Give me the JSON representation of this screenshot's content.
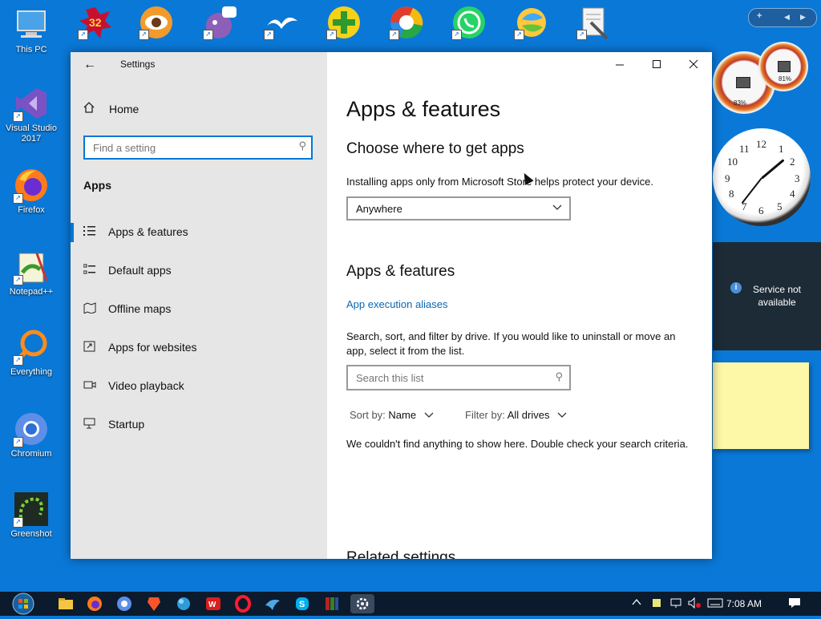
{
  "desktop": {
    "left_icons": [
      {
        "name": "This PC"
      },
      {
        "name": "Visual Studio 2017"
      },
      {
        "name": "Firefox"
      },
      {
        "name": "Notepad++"
      },
      {
        "name": "Everything"
      },
      {
        "name": "Chromium"
      },
      {
        "name": "Greenshot"
      }
    ],
    "top_icons": [
      {
        "badge": "32"
      },
      {
        "badge": ""
      },
      {
        "badge": ""
      },
      {
        "badge": ""
      },
      {
        "badge": ""
      },
      {
        "badge": ""
      },
      {
        "badge": ""
      },
      {
        "badge": ""
      },
      {
        "badge": ""
      }
    ],
    "gadget_bar": {
      "add": "+",
      "prev": "◀",
      "next": "▶"
    },
    "meters": [
      {
        "label": "83%"
      },
      {
        "label": "81%"
      }
    ],
    "clock_numbers": [
      "12",
      "1",
      "2",
      "3",
      "4",
      "5",
      "6",
      "7",
      "8",
      "9",
      "10",
      "11"
    ],
    "service": {
      "text": "Service not available"
    }
  },
  "window": {
    "title": "Settings",
    "sidebar": {
      "home": "Home",
      "search_placeholder": "Find a setting",
      "section": "Apps",
      "items": [
        {
          "label": "Apps & features",
          "icon": "list-icon",
          "selected": true
        },
        {
          "label": "Default apps",
          "icon": "default-apps-icon"
        },
        {
          "label": "Offline maps",
          "icon": "map-icon"
        },
        {
          "label": "Apps for websites",
          "icon": "web-link-icon"
        },
        {
          "label": "Video playback",
          "icon": "video-icon"
        },
        {
          "label": "Startup",
          "icon": "startup-icon"
        }
      ]
    },
    "content": {
      "title": "Apps & features",
      "choose_heading": "Choose where to get apps",
      "choose_desc": "Installing apps only from Microsoft Store helps protect your device.",
      "source_value": "Anywhere",
      "features_heading": "Apps & features",
      "aliases_link": "App execution aliases",
      "search_desc": "Search, sort, and filter by drive. If you would like to uninstall or move an app, select it from the list.",
      "list_search_placeholder": "Search this list",
      "sort_label": "Sort by:",
      "sort_value": "Name",
      "filter_label": "Filter by:",
      "filter_value": "All drives",
      "empty_message": "We couldn't find anything to show here. Double check your search criteria.",
      "related_heading": "Related settings"
    }
  },
  "taskbar": {
    "time": "7:08 AM"
  },
  "colors": {
    "accent": "#0078d7",
    "desktop": "#0a78d7",
    "sidebar": "#e6e6e6",
    "link": "#0a67b5"
  }
}
